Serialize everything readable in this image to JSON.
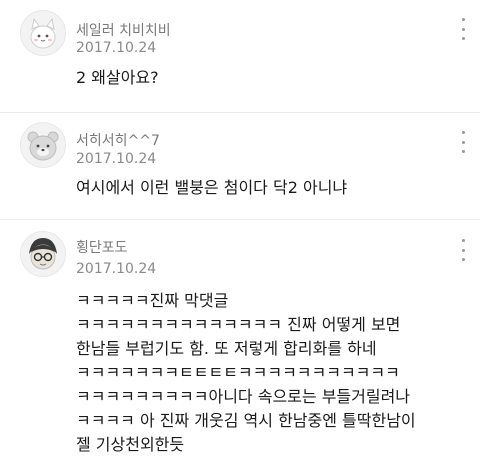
{
  "comments": [
    {
      "author": "세일러 치비치비",
      "date": "2017.10.24",
      "lines": [
        "2 왜살아요?"
      ],
      "avatar_icon": "cat-character-avatar",
      "menu_icon": "more-vertical-icon"
    },
    {
      "author": "서히서히^^7",
      "date": "2017.10.24",
      "lines": [
        "여시에서 이런 밸붕은 첨이다 닥2 아니냐"
      ],
      "avatar_icon": "bear-character-avatar",
      "menu_icon": "more-vertical-icon"
    },
    {
      "author": "횡단포도",
      "date": "2017.10.24",
      "lines": [
        "ㅋㅋㅋㅋㅋ진짜 막댓글",
        "ㅋㅋㅋㅋㅋㅋㅋㅋㅋㅋㅋㅋㅋㅋ 진짜 어떻게 보면",
        "한남들 부럽기도 함. 또 저렇게 합리화를 하네",
        "ㅋㅋㅋㅋㅋㅋㅋㅌㅌㅌㅌㅋㅋㅋㅋㅋㅋㅋㅋㅋㅋㅋ",
        "ㅋㅋㅋㅋㅋㅋㅋㅋㅋ아니다 속으로는 부들거릴려나",
        "ㅋㅋㅋㅋ 아 진짜 개웃김 역시 한남중엔 틀딱한남이",
        "젤 기상천외한듯"
      ],
      "avatar_icon": "glasses-character-avatar",
      "menu_icon": "more-vertical-icon"
    }
  ],
  "colors": {
    "author": "#7a7a7a",
    "date": "#8a8a8a",
    "text": "#1a1a1a",
    "divider": "#ececec"
  }
}
